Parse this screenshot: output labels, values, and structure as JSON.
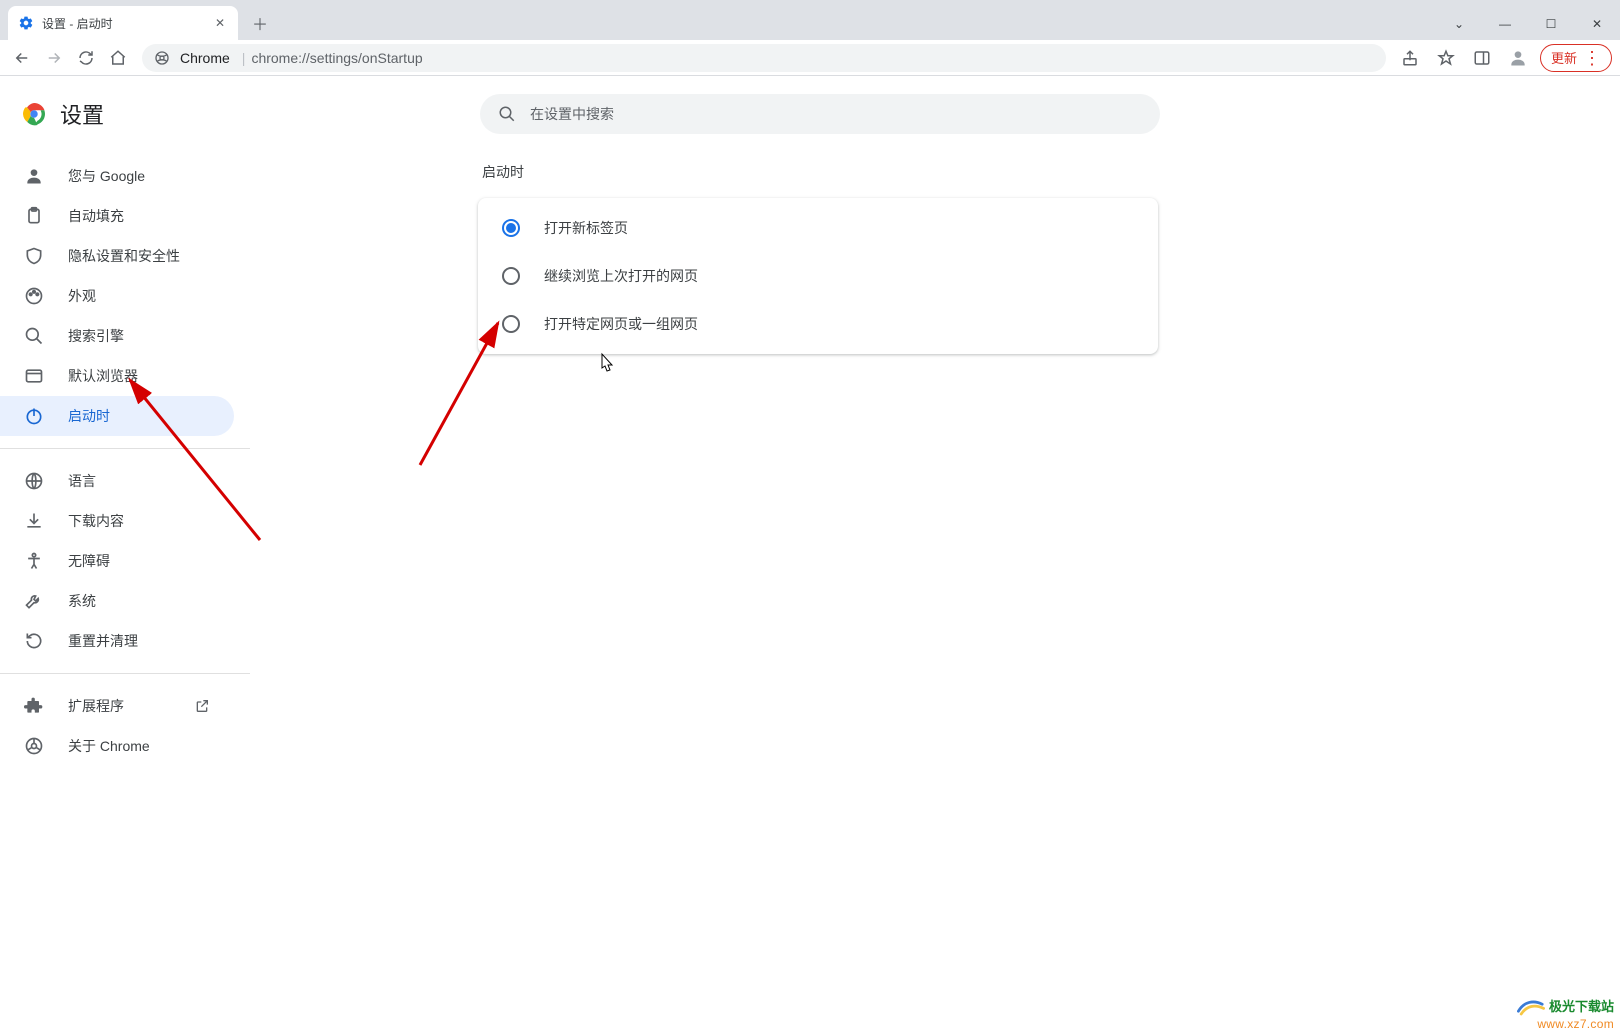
{
  "window": {
    "tab_title": "设置 - 启动时"
  },
  "omnibox": {
    "chip": "Chrome",
    "url": "chrome://settings/onStartup"
  },
  "toolbar": {
    "update_label": "更新"
  },
  "app": {
    "name": "设置",
    "search_placeholder": "在设置中搜索"
  },
  "sidebar": {
    "items": [
      {
        "label": "您与 Google"
      },
      {
        "label": "自动填充"
      },
      {
        "label": "隐私设置和安全性"
      },
      {
        "label": "外观"
      },
      {
        "label": "搜索引擎"
      },
      {
        "label": "默认浏览器"
      },
      {
        "label": "启动时"
      }
    ],
    "items2": [
      {
        "label": "语言"
      },
      {
        "label": "下载内容"
      },
      {
        "label": "无障碍"
      },
      {
        "label": "系统"
      },
      {
        "label": "重置并清理"
      }
    ],
    "items3": [
      {
        "label": "扩展程序"
      },
      {
        "label": "关于 Chrome"
      }
    ]
  },
  "section": {
    "title": "启动时",
    "options": [
      {
        "label": "打开新标签页",
        "checked": true
      },
      {
        "label": "继续浏览上次打开的网页",
        "checked": false
      },
      {
        "label": "打开特定网页或一组网页",
        "checked": false
      }
    ]
  },
  "watermark": {
    "line1": "极光下载站",
    "line2": "www.xz7.com"
  }
}
